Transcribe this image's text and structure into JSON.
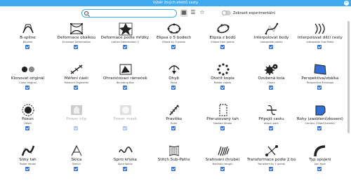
{
  "window": {
    "title": "Výběr živých efektů cesty"
  },
  "toolbar": {
    "search_placeholder": "",
    "experimental_label": "Zobrazit experimentální"
  },
  "effects": [
    {
      "name": "B-spline",
      "sub": "BSpline",
      "icon": "bspline-icon"
    },
    {
      "name": "Deformace obálkou",
      "sub": "Envelope Deformation",
      "icon": "envelope-icon"
    },
    {
      "name": "Deformace podle mřížky 2",
      "sub": "Lattice Deformation 2",
      "icon": "lattice-icon"
    },
    {
      "name": "Elipsa o 5 bodech",
      "sub": "Ellipse by 5 points",
      "icon": "ellipse5-icon"
    },
    {
      "name": "Elipsa z bodů",
      "sub": "Ellipse from points",
      "icon": "ellipse-points-icon"
    },
    {
      "name": "Interpolovat body",
      "sub": "Interpolate points",
      "icon": "interpolate-points-icon"
    },
    {
      "name": "Interpolovat dílčí cesty",
      "sub": "Interpolate Sub-Paths",
      "icon": "interpolate-subpaths-icon"
    },
    {
      "name": "Klonovat originál",
      "sub": "Clone original",
      "icon": "clone-original-icon"
    },
    {
      "name": "Měření části",
      "sub": "Measure Segments",
      "icon": "measure-segments-icon"
    },
    {
      "name": "Ohraničovací rámeček",
      "sub": "Bounding Box",
      "icon": "bounding-box-icon"
    },
    {
      "name": "Ohyb",
      "sub": "Bend",
      "icon": "bend-icon"
    },
    {
      "name": "Otočit kopie",
      "sub": "Rotate copies",
      "icon": "rotate-copies-icon"
    },
    {
      "name": "Ozubená kola",
      "sub": "Gears",
      "icon": "gears-icon"
    },
    {
      "name": "Perspektiva/obálka",
      "sub": "Perspective/Envelope",
      "icon": "perspective-icon"
    },
    {
      "name": "Posun",
      "sub": "Offset",
      "icon": "offset-icon"
    },
    {
      "name": "Power clip",
      "sub": "",
      "icon": "power-clip-icon",
      "disabled": true
    },
    {
      "name": "Power mask",
      "sub": "",
      "icon": "power-mask-icon",
      "disabled": true
    },
    {
      "name": "Pravítko",
      "sub": "Ruler",
      "icon": "ruler-icon"
    },
    {
      "name": "Přerušovaný tah",
      "sub": "Dashed Stroke",
      "icon": "dashed-stroke-icon"
    },
    {
      "name": "Připojit cestu",
      "sub": "Attach path",
      "icon": "attach-path-icon"
    },
    {
      "name": "Rohy (zaoblení/zkosení)",
      "sub": "Corners (Fillet/Chamfer)",
      "icon": "corners-icon"
    },
    {
      "name": "Silný tah",
      "sub": "Power stroke",
      "icon": "power-stroke-icon"
    },
    {
      "name": "Skica",
      "sub": "Sketch",
      "icon": "sketch-icon"
    },
    {
      "name": "Spiro křivka",
      "sub": "Spiro spline",
      "icon": "spiro-icon"
    },
    {
      "name": "Stitch Sub-Paths",
      "sub": "",
      "icon": "stitch-icon"
    },
    {
      "name": "Šrafování (hrubé)",
      "sub": "Hatches (rough)",
      "icon": "hatches-icon"
    },
    {
      "name": "Transformace podle 2 bo...",
      "sub": "Transform by 2 points",
      "icon": "transform-2-points-icon"
    },
    {
      "name": "Typ spojení",
      "sub": "Join type",
      "icon": "join-type-icon"
    }
  ]
}
